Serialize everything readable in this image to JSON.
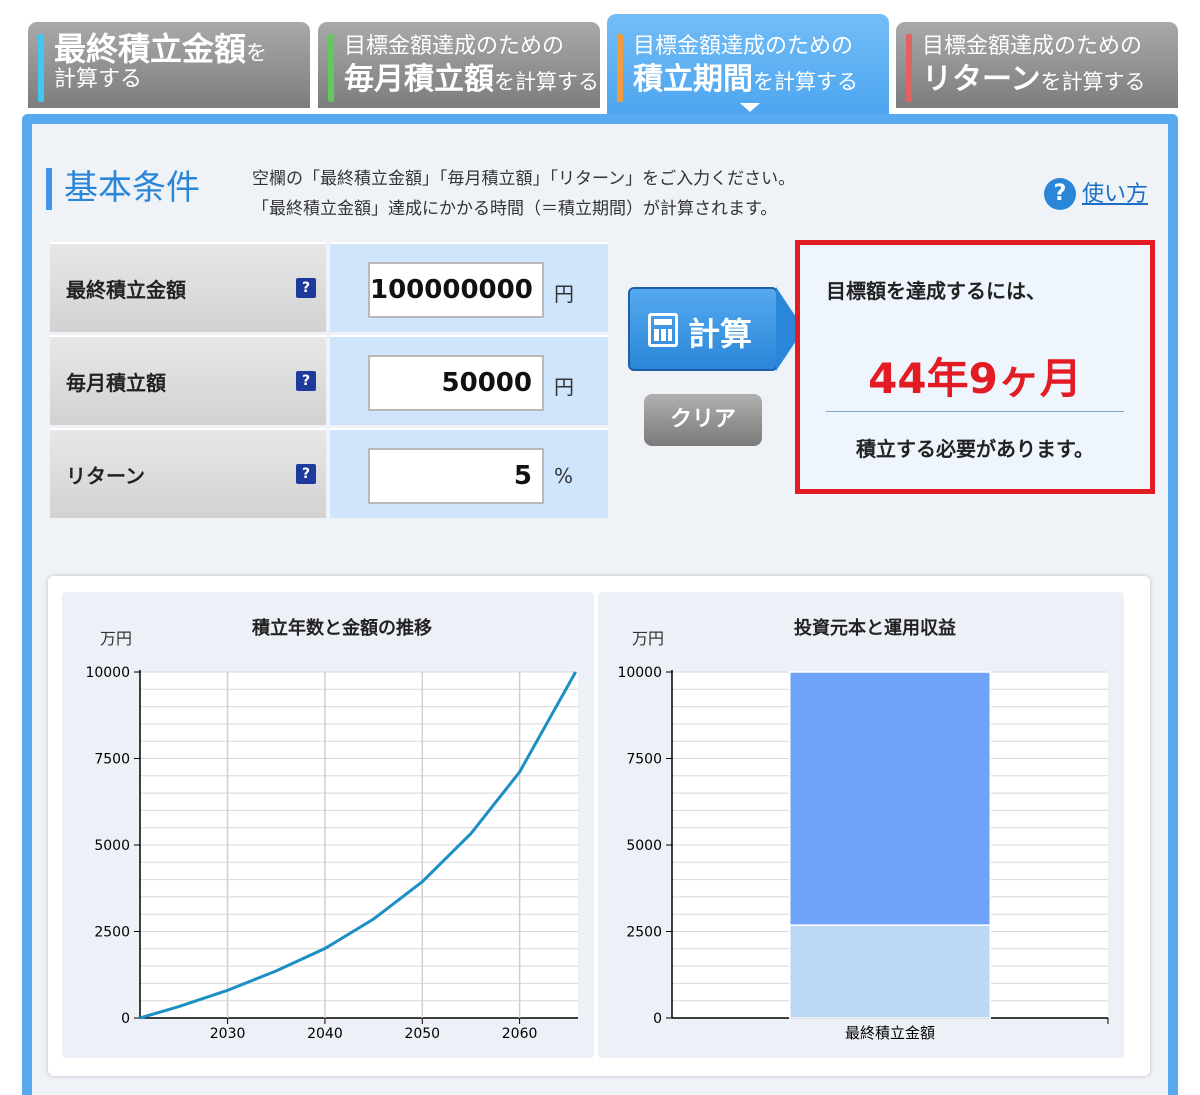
{
  "tabs": [
    {
      "line1_big": "最終積立金額",
      "line1_small": "を",
      "line2_small": "計算する",
      "bar_color": "#3fc9f0"
    },
    {
      "line1": "目標金額達成のための",
      "line2_big": "毎月積立額",
      "line2_small": "を計算する",
      "bar_color": "#63c95a"
    },
    {
      "line1": "目標金額達成のための",
      "line2_big": "積立期間",
      "line2_small": "を計算する",
      "bar_color": "#f39a3b"
    },
    {
      "line1": "目標金額達成のための",
      "line2_big": "リターン",
      "line2_small": "を計算する",
      "bar_color": "#e26163"
    }
  ],
  "section": {
    "title": "基本条件",
    "intro_line1": "空欄の「最終積立金額」「毎月積立額」「リターン」をご入力ください。",
    "intro_line2": "「最終積立金額」達成にかかる時間（＝積立期間）が計算されます。",
    "help_icon": "?",
    "help_label": "使い方"
  },
  "inputs": [
    {
      "label": "最終積立金額",
      "value": "100000000",
      "unit": "円"
    },
    {
      "label": "毎月積立額",
      "value": "50000",
      "unit": "円"
    },
    {
      "label": "リターン",
      "value": "5",
      "unit": "%"
    }
  ],
  "help_q_icon": "?",
  "buttons": {
    "calc": "計算",
    "clear": "クリア"
  },
  "result": {
    "intro": "目標額を達成するには、",
    "value": "44年9ヶ月",
    "outro": "積立する必要があります。"
  },
  "chart_data": [
    {
      "type": "line",
      "title": "積立年数と金額の推移",
      "ylabel": "万円",
      "xlabel": "",
      "x": [
        2021,
        2025,
        2030,
        2035,
        2040,
        2045,
        2050,
        2055,
        2060,
        2065.75
      ],
      "y": [
        0,
        330,
        800,
        1360,
        2010,
        2860,
        3940,
        5330,
        7110,
        10000
      ],
      "xticks": [
        2030,
        2040,
        2050,
        2060
      ],
      "yticks": [
        0,
        2500,
        5000,
        7500,
        10000
      ],
      "xlim": [
        2021,
        2066
      ],
      "ylim": [
        0,
        10000
      ],
      "grid": true,
      "color": "#1c8fc4"
    },
    {
      "type": "bar",
      "stacked": true,
      "title": "投資元本と運用収益",
      "ylabel": "万円",
      "categories": [
        "最終積立金額"
      ],
      "series": [
        {
          "values": [
            2685
          ],
          "color": "#bcd8f5"
        },
        {
          "values": [
            7315
          ],
          "color": "#70a3fa"
        }
      ],
      "yticks": [
        0,
        2500,
        5000,
        7500,
        10000
      ],
      "ylim": [
        0,
        10000
      ],
      "grid": true
    }
  ]
}
